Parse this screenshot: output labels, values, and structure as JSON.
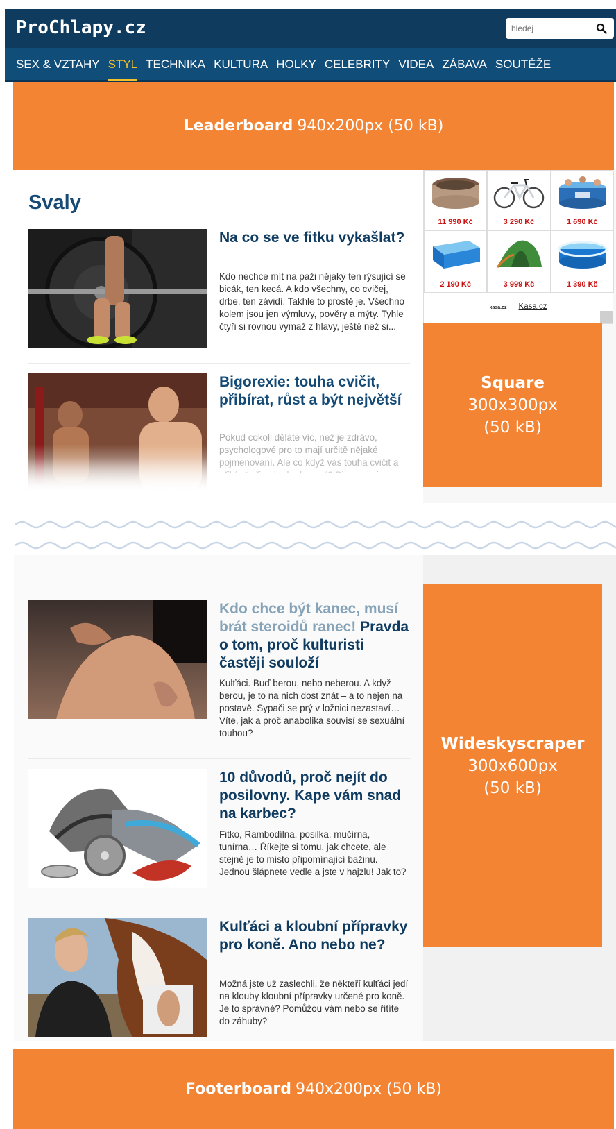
{
  "header": {
    "logo": "ProChlapy.cz",
    "search_placeholder": "hledej"
  },
  "nav": {
    "items": [
      {
        "label": "SEX & VZTAHY",
        "active": false
      },
      {
        "label": "STYL",
        "active": true
      },
      {
        "label": "TECHNIKA",
        "active": false
      },
      {
        "label": "KULTURA",
        "active": false
      },
      {
        "label": "HOLKY",
        "active": false
      },
      {
        "label": "CELEBRITY",
        "active": false
      },
      {
        "label": "VIDEA",
        "active": false
      },
      {
        "label": "ZÁBAVA",
        "active": false
      },
      {
        "label": "SOUTĚŽE",
        "active": false
      }
    ],
    "active_color": "#f3c12b"
  },
  "ads": {
    "leaderboard": {
      "name": "Leaderboard",
      "size": "940x200px (50 kB)"
    },
    "square": {
      "name": "Square",
      "size_line1": "300x300px",
      "size_line2": "(50 kB)"
    },
    "wideskyscraper": {
      "name": "Wideskyscraper",
      "size_line1": "300x600px",
      "size_line2": "(50 kB)"
    },
    "footerboard": {
      "name": "Footerboard",
      "size": "940x200px (50 kB)"
    },
    "color": "#f38434"
  },
  "section": {
    "title": "Svaly"
  },
  "articles": [
    {
      "headline": "Na co se ve fitku vykašlat?",
      "perex": "Kdo nechce mít na paži nějaký ten rýsující se bicák, ten kecá. A kdo všechny, co cvičej, drbe, ten závidí. Takhle to prostě je. Všechno kolem jsou jen výmluvy, pověry a mýty. Tyhle čtyři si rovnou vymaž z hlavy, ještě než si..."
    },
    {
      "headline": "Bigorexie: touha cvičit, přibírat, růst a být největší",
      "perex": "Pokud cokoli děláte víc, než je zdrávo, psychologové pro to mají určitě nějaké pojmenování. Ale co když vás touha cvičit a přibírat přivede do depresí? Bigorexie je"
    },
    {
      "headline": "Kdo chce být kanec, musí brát steroidů ranec! Pravda o tom, proč kulturisti častěji souloží",
      "perex": "Kulťáci. Buď berou, nebo neberou. A když berou, je to na nich dost znát – a to nejen na postavě. Sypači se prý v ložnici nezastaví… Víte, jak a proč anabolika souvisí se sexuální touhou?"
    },
    {
      "headline": "10 důvodů, proč nejít do posilovny. Kape vám snad na karbec?",
      "perex": "Fitko, Rambodílna, posilka, mučírna, tunírna… Říkejte si tomu, jak chcete, ale stejně je to místo připomínající bažinu. Jednou šlápnete vedle a jste v hajzlu! Jak to?"
    },
    {
      "headline": "Kulťáci a kloubní přípravky pro koně. Ano nebo ne?",
      "perex": "Možná jste už zaslechli, že někteří kulťáci jedí na klouby kloubní přípravky určené pro koně. Je to správné? Pomůžou vám nebo se řítíte do záhuby?"
    }
  ],
  "kasa": {
    "products": [
      {
        "price": "11 990 Kč",
        "icon": "hot-tub-icon"
      },
      {
        "price": "3 290 Kč",
        "icon": "bicycle-icon"
      },
      {
        "price": "1 690 Kč",
        "icon": "pool-icon"
      },
      {
        "price": "2 190 Kč",
        "icon": "frame-pool-icon"
      },
      {
        "price": "3 999 Kč",
        "icon": "tent-icon"
      },
      {
        "price": "1 390 Kč",
        "icon": "inflatable-pool-icon"
      }
    ],
    "mini_logo": "kasa.cz",
    "link": "Kasa.cz",
    "price_color": "#cc1111"
  }
}
